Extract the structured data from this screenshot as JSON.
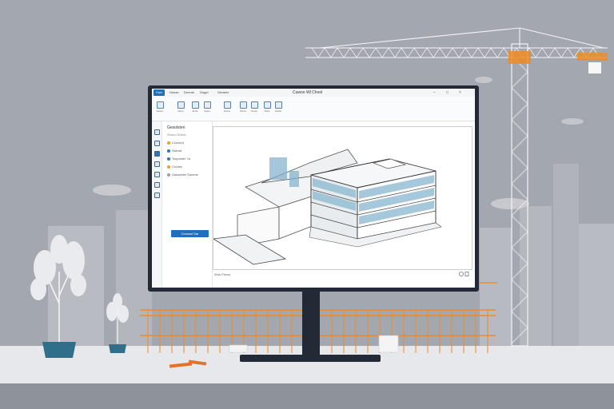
{
  "app": {
    "window_title": "Cuwoo Wl Chool",
    "tabs": [
      "Fwd",
      "House",
      "Denoto",
      "Dugei",
      "Geoster"
    ],
    "window_controls": [
      "−",
      "□",
      "×"
    ]
  },
  "ribbon": {
    "buttons": [
      {
        "label": "Sedon",
        "icon": "section-icon"
      },
      {
        "label": "Doos",
        "icon": "door-icon"
      },
      {
        "label": "Ensit",
        "icon": "insert-icon"
      },
      {
        "label": "Sears",
        "icon": "search-icon"
      },
      {
        "label": "Sonoe",
        "icon": "stone-icon"
      },
      {
        "label": "Nivom",
        "icon": "view-icon"
      },
      {
        "label": "Teuse",
        "icon": "tools-icon"
      },
      {
        "label": "Teste",
        "icon": "test-icon"
      },
      {
        "label": "Sonks",
        "icon": "stack-icon"
      }
    ]
  },
  "panel": {
    "title": "Gesolsten",
    "subtitle": "Stumd Sdeuc",
    "rows": [
      "Cvcnurd",
      "Swimd",
      "Tsoposter 7a",
      "Crooes",
      "Sasoobee Socrme"
    ],
    "button_label": "Censsst Sar"
  },
  "statusbar": {
    "text": "Wus Peoos"
  },
  "colors": {
    "accent": "#1f6fbd",
    "sky": "#a3a7af",
    "scaffold": "#f08a24",
    "crane": "#f2f3f5"
  }
}
